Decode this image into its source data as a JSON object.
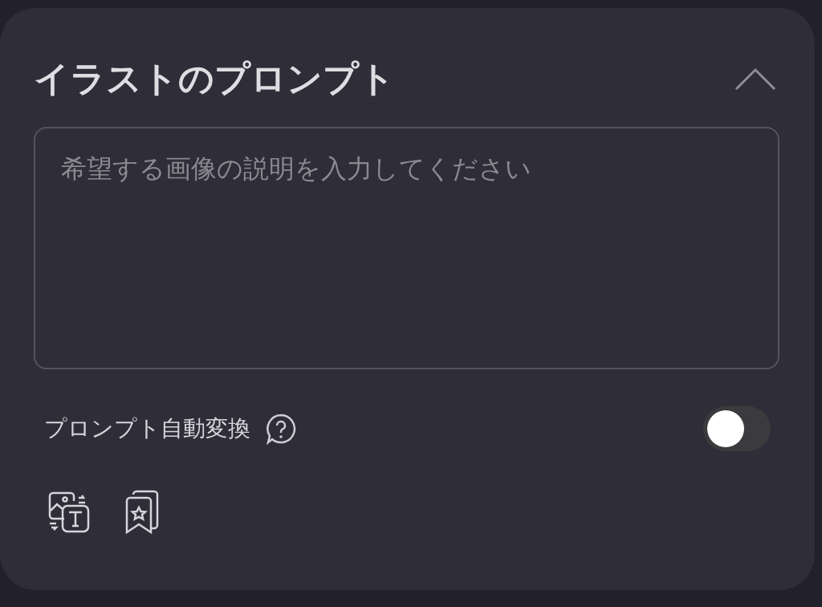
{
  "panel": {
    "title": "イラストのプロンプト",
    "expanded": true
  },
  "prompt_field": {
    "placeholder": "希望する画像の説明を入力してください"
  },
  "auto_convert": {
    "label": "プロンプト自動変換",
    "on": false
  }
}
